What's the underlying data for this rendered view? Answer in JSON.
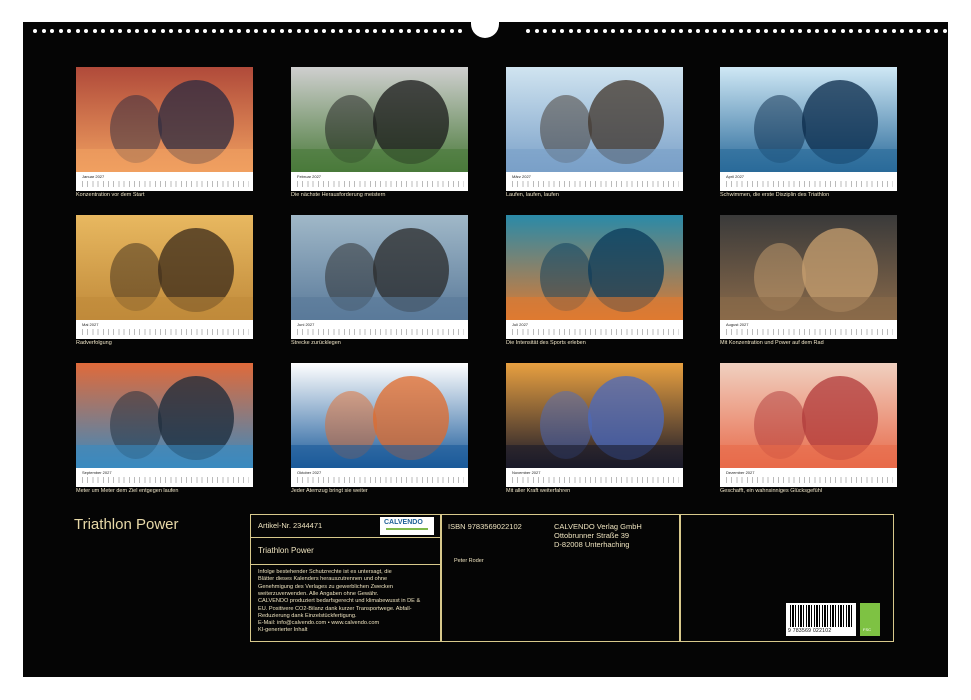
{
  "title": "Triathlon Power",
  "months": [
    {
      "name": "Januar 2027",
      "caption": "Konzentration vor dem Start",
      "icon": "swimmers-at-start-photo"
    },
    {
      "name": "Februar 2027",
      "caption": "Die nächste Herausforderung meistern",
      "icon": "cyclists-photo"
    },
    {
      "name": "März 2027",
      "caption": "Laufen, laufen, laufen",
      "icon": "runners-splash-photo"
    },
    {
      "name": "April 2027",
      "caption": "Schwimmen, die erste Disziplin des Triathlon",
      "icon": "open-water-swim-photo"
    },
    {
      "name": "Mai 2027",
      "caption": "Radverfolgung",
      "icon": "cycling-pursuit-photo"
    },
    {
      "name": "Juni 2027",
      "caption": "Strecke zurücklegen",
      "icon": "runner-motion-blur-photo"
    },
    {
      "name": "Juli 2027",
      "caption": "Die Intensität des Sports erleben",
      "icon": "swimmer-closeup-photo"
    },
    {
      "name": "August 2027",
      "caption": "Mit Konzentration und Power auf dem Rad",
      "icon": "cyclist-closeup-photo"
    },
    {
      "name": "September 2027",
      "caption": "Meter um Meter dem Ziel entgegen laufen",
      "icon": "marathon-runners-photo"
    },
    {
      "name": "Oktober 2027",
      "caption": "Jeder Atemzug bringt sie weiter",
      "icon": "swimmers-orange-caps-photo"
    },
    {
      "name": "November 2027",
      "caption": "Mit aller Kraft weiterfahren",
      "icon": "night-cyclist-photo"
    },
    {
      "name": "Dezember 2027",
      "caption": "Geschafft, ein wahnsinniges Glücksgefühl",
      "icon": "finish-line-celebration-photo"
    }
  ],
  "info": {
    "article": "Artikel-Nr. 2344471",
    "logo_text": "CALVENDO",
    "product_title": "Triathlon Power",
    "legal_lines": [
      "Infolge bestehender Schutzrechte ist es untersagt, die",
      "Blätter dieses Kalenders herauszutrennen und ohne",
      "Genehmigung des Verlages zu gewerblichen Zwecken",
      "weiterzuverwenden. Alle Angaben ohne Gewähr.",
      "CALVENDO produziert bedarfsgerecht und klimabewusst in DE &",
      "EU. Positivere CO2-Bilanz dank kurzer Transportwege. Abfall-",
      "Reduzierung dank Einzelstückfertigung.",
      "E-Mail: info@calvendo.com • www.calvendo.com",
      "KI-generierter Inhalt"
    ],
    "isbn": "ISBN 9783569022102",
    "author": "Peter Roder",
    "publisher_lines": [
      "CALVENDO Verlag GmbH",
      "Ottobrunner Straße 39",
      "D-82008 Unterhaching"
    ],
    "barcode_number": "9 783569 022102"
  },
  "colors": {
    "background": "#050505",
    "accent": "#d8c98c",
    "text": "#eee3bf"
  }
}
